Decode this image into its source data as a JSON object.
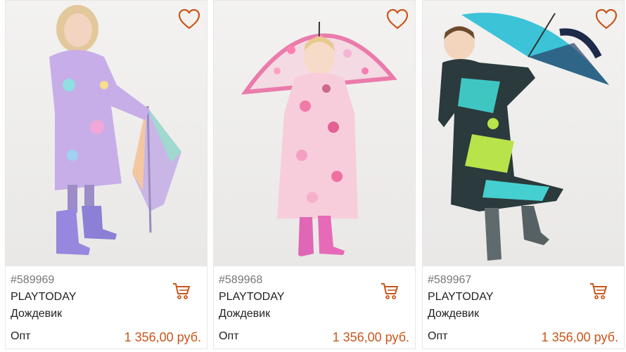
{
  "accent_color": "#c8561c",
  "icons": {
    "favorite": "heart-outline-icon",
    "cart": "shopping-cart-icon"
  },
  "products": [
    {
      "sku": "#589969",
      "brand": "PLAYTODAY",
      "type": "Дождевик",
      "price_label": "Опт",
      "price": "1 356,00 руб.",
      "image": "girl-in-lilac-raincoat-with-pastel-umbrella"
    },
    {
      "sku": "#589968",
      "brand": "PLAYTODAY",
      "type": "Дождевик",
      "price_label": "Опт",
      "price": "1 356,00 руб.",
      "image": "girl-in-donut-print-raincoat-with-clear-pink-umbrella"
    },
    {
      "sku": "#589967",
      "brand": "PLAYTODAY",
      "type": "Дождевик",
      "price_label": "Опт",
      "price": "1 356,00 руб.",
      "image": "boy-in-graphic-raincoat-with-turquoise-umbrella"
    }
  ]
}
